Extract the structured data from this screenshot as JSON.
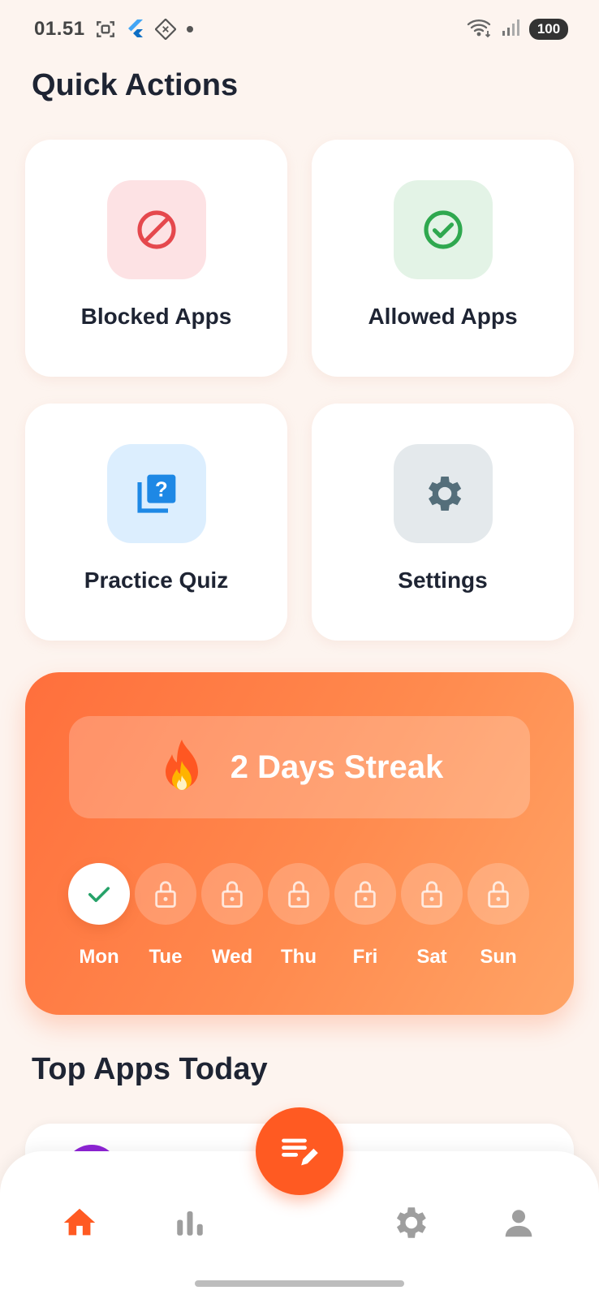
{
  "status_bar": {
    "time": "01.51",
    "battery": "100"
  },
  "quick_actions": {
    "title": "Quick Actions",
    "items": [
      {
        "label": "Blocked Apps",
        "icon": "block-icon",
        "icon_color": "#e5484d",
        "tile_color": "#fde2e4"
      },
      {
        "label": "Allowed Apps",
        "icon": "check-circle-icon",
        "icon_color": "#2fa84f",
        "tile_color": "#e3f3e6"
      },
      {
        "label": "Practice Quiz",
        "icon": "quiz-icon",
        "icon_color": "#1e88e5",
        "tile_color": "#dceefe"
      },
      {
        "label": "Settings",
        "icon": "gear-icon",
        "icon_color": "#546e7a",
        "tile_color": "#e4e9ec"
      }
    ]
  },
  "streak": {
    "text": "2 Days Streak",
    "icon": "fire-icon",
    "days": [
      {
        "label": "Mon",
        "completed": true
      },
      {
        "label": "Tue",
        "completed": false
      },
      {
        "label": "Wed",
        "completed": false
      },
      {
        "label": "Thu",
        "completed": false
      },
      {
        "label": "Fri",
        "completed": false
      },
      {
        "label": "Sat",
        "completed": false
      },
      {
        "label": "Sun",
        "completed": false
      }
    ]
  },
  "top_apps": {
    "title": "Top Apps Today"
  },
  "bottom_nav": {
    "items": [
      "home-icon",
      "stats-icon",
      "gear-icon",
      "profile-icon"
    ],
    "active": "home-icon",
    "accent": "#ff5a22",
    "fab_icon": "edit-note-icon"
  }
}
